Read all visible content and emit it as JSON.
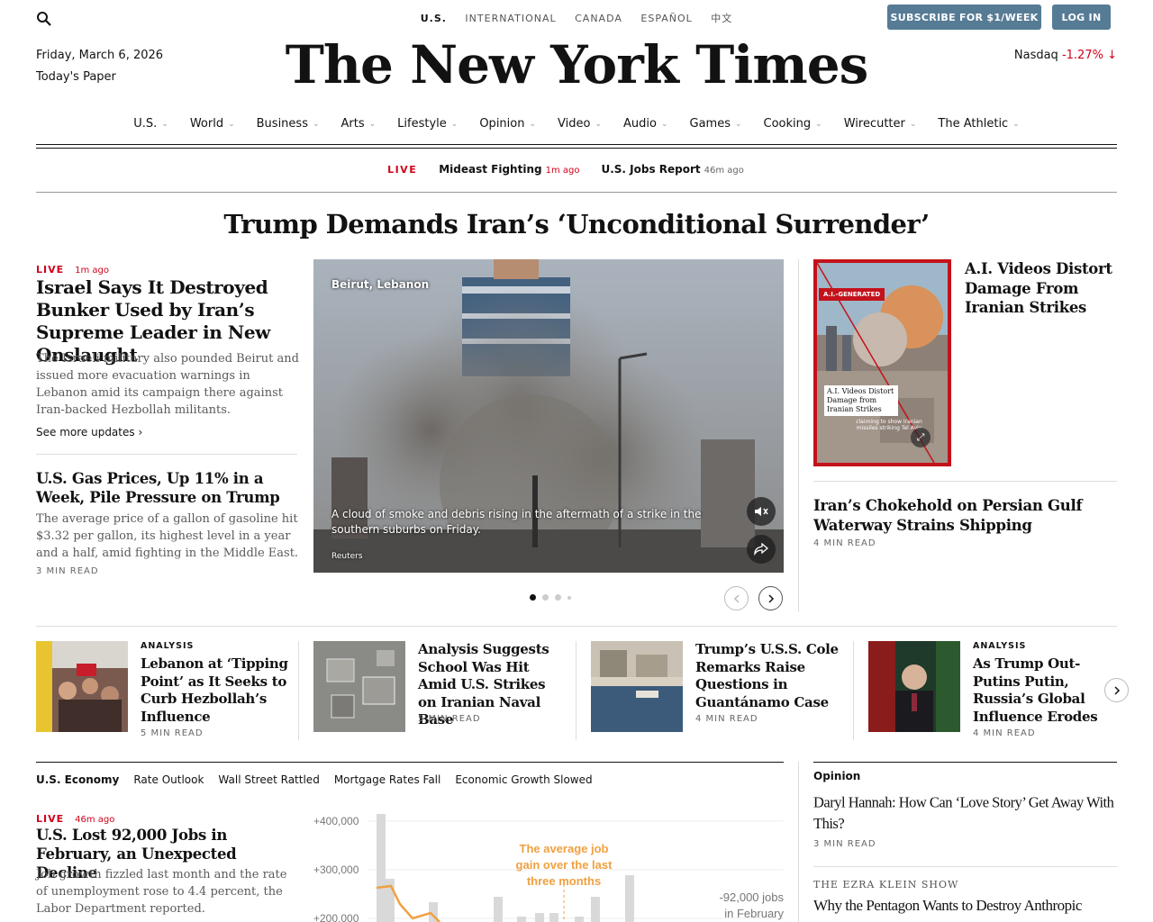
{
  "header": {
    "editions": [
      "U.S.",
      "INTERNATIONAL",
      "CANADA",
      "ESPAÑOL",
      "中文"
    ],
    "subscribe_label": "SUBSCRIBE FOR $1/WEEK",
    "login_label": "LOG IN",
    "date": "Friday, March 6, 2026",
    "todays_paper": "Today's Paper",
    "masthead": "The New York Times",
    "market_name": "Nasdaq",
    "market_change": "-1.27%",
    "market_arrow": "↓"
  },
  "nav": [
    "U.S.",
    "World",
    "Business",
    "Arts",
    "Lifestyle",
    "Opinion",
    "Video",
    "Audio",
    "Games",
    "Cooking",
    "Wirecutter",
    "The Athletic"
  ],
  "livebar": {
    "label": "LIVE",
    "items": [
      {
        "title": "Mideast Fighting",
        "time": "1m ago"
      },
      {
        "title": "U.S. Jobs Report",
        "time": "46m ago"
      }
    ]
  },
  "top_headline": "Trump Demands Iran’s ‘Unconditional Surrender’",
  "lead": {
    "live": "LIVE",
    "time": "1m ago",
    "headline": "Israel Says It Destroyed Bunker Used by Iran’s Supreme Leader in New Onslaught",
    "summary": "The Israeli military also pounded Beirut and issued more evacuation warnings in Lebanon amid its campaign there against Iran-backed Hezbollah militants.",
    "more": "See more updates ›"
  },
  "gas": {
    "headline": "U.S. Gas Prices, Up 11% in a Week, Pile Pressure on Trump",
    "summary": "The average price of a gallon of gasoline hit $3.32 per gallon, its highest level in a year and a half, amid fighting in the Middle East.",
    "read": "3 MIN READ"
  },
  "main_image": {
    "location": "Beirut, Lebanon",
    "caption": "A cloud of smoke and debris rising in the aftermath of a strike in the southern suburbs on Friday.",
    "credit": "Reuters"
  },
  "ai_story": {
    "badge": "A.I.-GENERATED",
    "thumb_caption": "A.I. Videos Distort Damage from Iranian Strikes",
    "thumb_small": "claiming to show Iranian missiles striking Tel Aviv",
    "headline": "A.I. Videos Distort Damage From Iranian Strikes"
  },
  "choke": {
    "headline": "Iran’s Chokehold on Persian Gulf Waterway Strains Shipping",
    "read": "4 MIN READ"
  },
  "row": [
    {
      "kicker": "ANALYSIS",
      "headline": "Lebanon at ‘Tipping Point’ as It Seeks to Curb Hezbollah’s Influence",
      "read": "5 MIN READ"
    },
    {
      "kicker": "",
      "headline": "Analysis Suggests School Was Hit Amid U.S. Strikes on Iranian Naval Base",
      "read": "5 MIN READ"
    },
    {
      "kicker": "",
      "headline": "Trump’s U.S.S. Cole Remarks Raise Questions in Guantánamo Case",
      "read": "4 MIN READ"
    },
    {
      "kicker": "ANALYSIS",
      "headline": "As Trump Out-Putins Putin, Russia’s Global Influence Erodes",
      "read": "4 MIN READ"
    }
  ],
  "economy": {
    "section": "U.S. Economy",
    "links": [
      "Rate Outlook",
      "Wall Street Rattled",
      "Mortgage Rates Fall",
      "Economic Growth Slowed"
    ],
    "live": "LIVE",
    "time": "46m ago",
    "headline": "U.S. Lost 92,000 Jobs in February, an Unexpected Decline",
    "summary": "Job growth fizzled last month and the rate of unemployment rose to 4.4 percent, the Labor Department reported."
  },
  "chart_data": {
    "type": "bar",
    "ylabels": [
      "+400,000",
      "+300,000",
      "+200,000"
    ],
    "annotation": "The average job gain over the last three months",
    "callout": "-92,000 jobs in February",
    "colors": {
      "bars": "#d9d9d9",
      "line": "#f0a040",
      "annotation": "#f0a040"
    }
  },
  "opinion": {
    "label": "Opinion",
    "headline": "Daryl Hannah: How Can ‘Love Story’ Get Away With This?",
    "read": "3 MIN READ",
    "show": "THE EZRA KLEIN SHOW",
    "show_headline": "Why the Pentagon Wants to Destroy Anthropic"
  }
}
